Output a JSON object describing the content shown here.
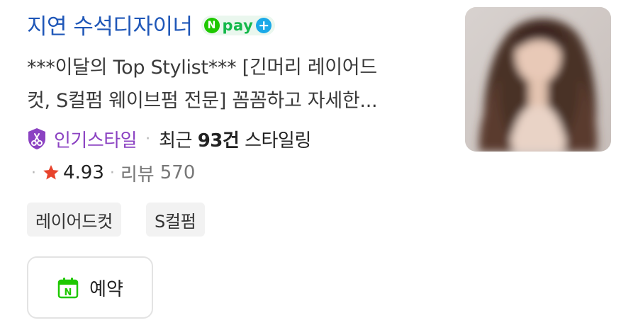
{
  "listing": {
    "name": "지연 수석디자이너",
    "npay": {
      "n": "N",
      "text": "pay",
      "plus": "+"
    },
    "description": "***이달의 Top Stylist*** [긴머리 레이어드\n컷, S컬펌 웨이브펌 전문] 꼼꼼하고 자세한...",
    "badge_label": "인기스타일",
    "separator": "·",
    "recent_prefix": "최근 ",
    "recent_count": "93건",
    "recent_suffix": " 스타일링",
    "rating": "4.93",
    "review_label": "리뷰",
    "review_count": "570",
    "tags": [
      "레이어드컷",
      "S컬펌"
    ],
    "book_label": "예약",
    "book_icon_letter": "N"
  },
  "icons": {
    "badge": "popular-style-badge-icon",
    "star": "star-icon",
    "book": "calendar-icon",
    "photo": "stylist-photo"
  },
  "colors": {
    "title": "#1f57b8",
    "npay_green": "#14b84a",
    "npay_plus": "#1aa9e8",
    "badge_purple": "#8b42c2",
    "star_red": "#e8432c",
    "book_green": "#1ec800"
  }
}
